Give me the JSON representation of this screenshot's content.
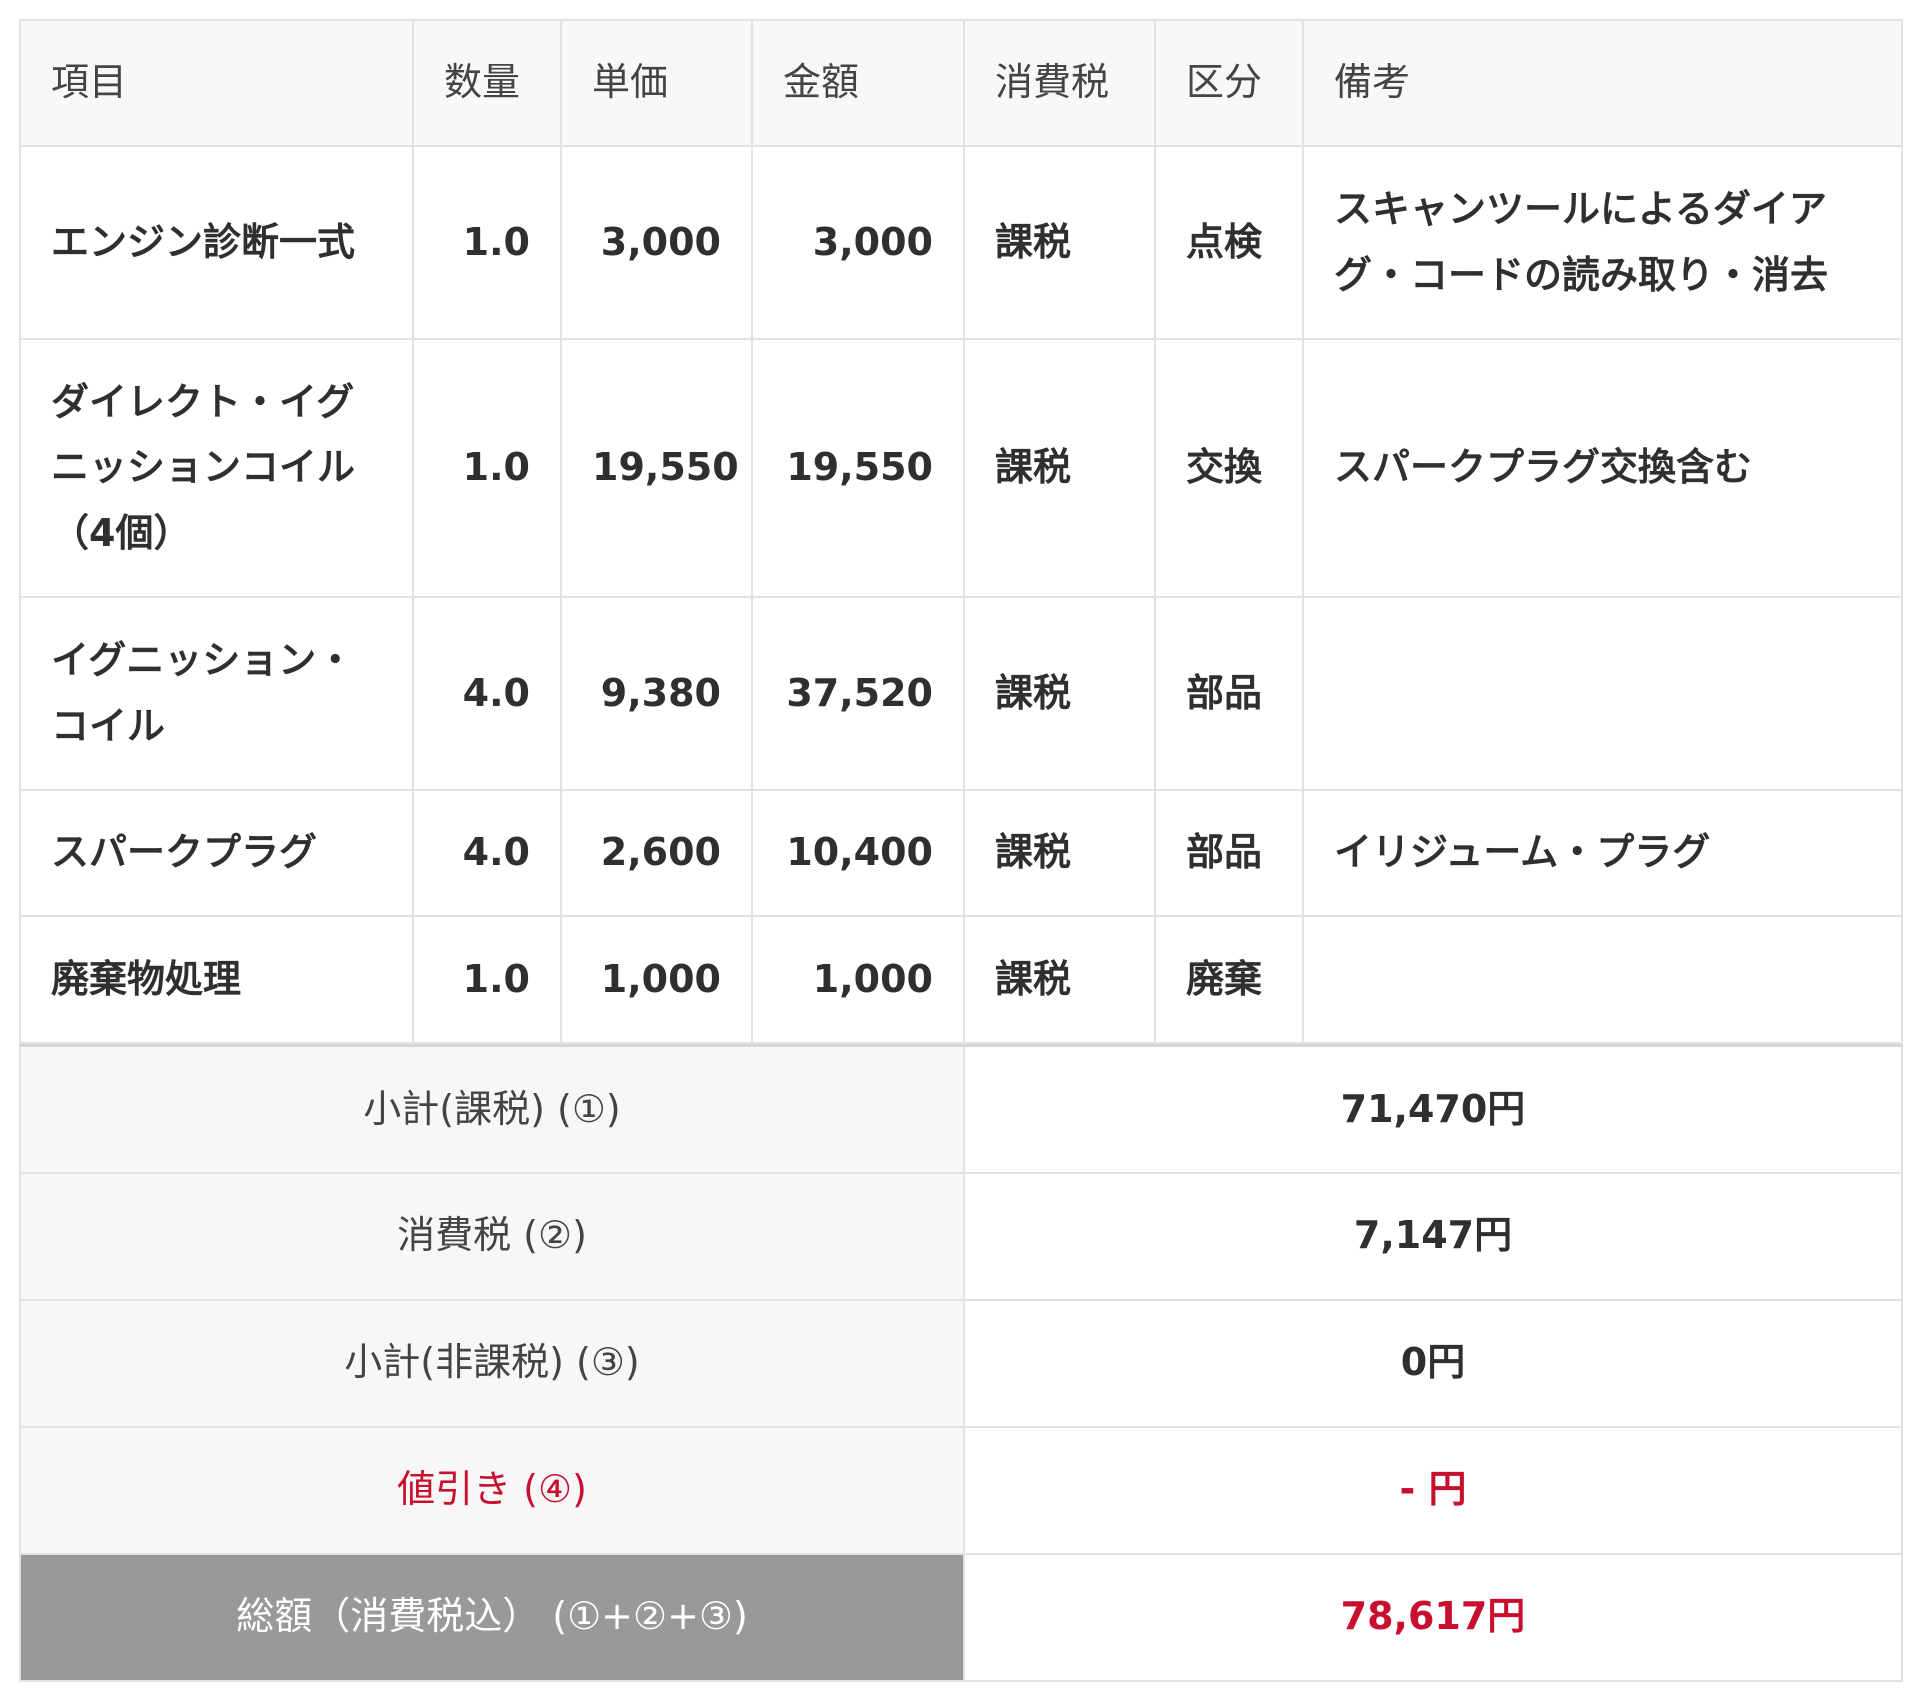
{
  "headers": [
    "項目",
    "数量",
    "単価",
    "金額",
    "消費税",
    "区分",
    "備考"
  ],
  "rows": [
    {
      "item": "エンジン診断一式",
      "qty": "1.0",
      "unit_price": "3,000",
      "amount": "3,000",
      "tax": "課税",
      "category": "点検",
      "note": "スキャンツールによるダイアグ・コードの読み取り・消去"
    },
    {
      "item": "ダイレクト・イグニッションコイル（4個）",
      "qty": "1.0",
      "unit_price": "19,550",
      "amount": "19,550",
      "tax": "課税",
      "category": "交換",
      "note": "スパークプラグ交換含む"
    },
    {
      "item": "イグニッション・コイル",
      "qty": "4.0",
      "unit_price": "9,380",
      "amount": "37,520",
      "tax": "課税",
      "category": "部品",
      "note": ""
    },
    {
      "item": "スパークプラグ",
      "qty": "4.0",
      "unit_price": "2,600",
      "amount": "10,400",
      "tax": "課税",
      "category": "部品",
      "note": "イリジューム・プラグ"
    },
    {
      "item": "廃棄物処理",
      "qty": "1.0",
      "unit_price": "1,000",
      "amount": "1,000",
      "tax": "課税",
      "category": "廃棄",
      "note": ""
    }
  ],
  "summary": {
    "subtotal_taxable": {
      "label": "小計(課税) (①)",
      "value": "71,470円"
    },
    "consumption_tax": {
      "label": "消費税 (②)",
      "value": "7,147円"
    },
    "subtotal_nontaxable": {
      "label": "小計(非課税) (③)",
      "value": "0円"
    },
    "discount": {
      "label": "値引き (④)",
      "value": "- 円"
    },
    "total": {
      "label": "総額（消費税込） (①+②+③)",
      "value": "78,617円"
    }
  },
  "colors": {
    "accent_red": "#c8102e",
    "total_label_bg": "#999999",
    "header_bg": "#f8f8f8",
    "border": "#e2e2e2"
  }
}
